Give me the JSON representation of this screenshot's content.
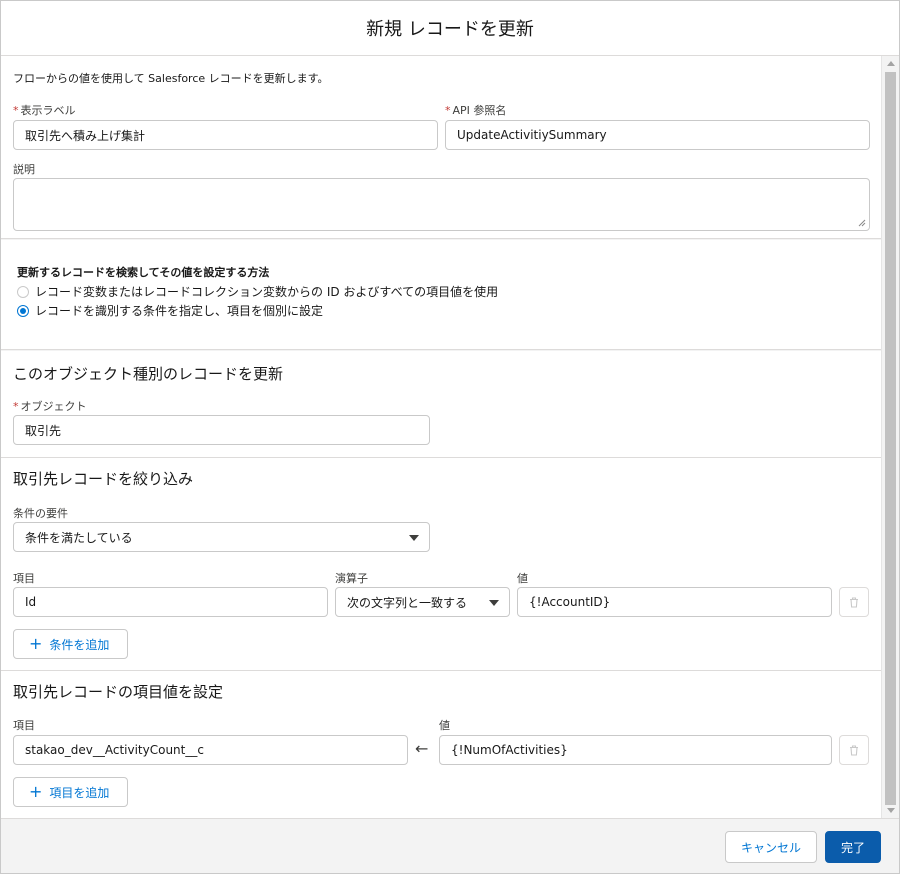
{
  "modal": {
    "title": "新規 レコードを更新",
    "footer": {
      "cancel_label": "キャンセル",
      "done_label": "完了"
    }
  },
  "header_section": {
    "description_text": "フローからの値を使用して Salesforce レコードを更新します。",
    "label_field": {
      "required_mark": "*",
      "label": "表示ラベル",
      "value": "取引先へ積み上げ集計"
    },
    "api_name_field": {
      "required_mark": "*",
      "label": "API 参照名",
      "value": "UpdateActivitiySummary"
    },
    "description_field": {
      "label": "説明",
      "value": ""
    }
  },
  "method_section": {
    "title": "更新するレコードを検索してその値を設定する方法",
    "options": [
      {
        "label": "レコード変数またはレコードコレクション変数からの ID およびすべての項目値を使用",
        "selected": false
      },
      {
        "label": "レコードを識別する条件を指定し、項目を個別に設定",
        "selected": true
      }
    ]
  },
  "object_section": {
    "title": "このオブジェクト種別のレコードを更新",
    "object_field": {
      "required_mark": "*",
      "label": "オブジェクト",
      "value": "取引先"
    }
  },
  "filter_section": {
    "title": "取引先レコードを絞り込み",
    "condition_requirement": {
      "label": "条件の要件",
      "value": "条件を満たしている"
    },
    "columns": {
      "field": "項目",
      "operator": "演算子",
      "value": "値"
    },
    "row": {
      "field": "Id",
      "operator": "次の文字列と一致する",
      "value": "{!AccountID}"
    },
    "add_label": "条件を追加"
  },
  "set_section": {
    "title": "取引先レコードの項目値を設定",
    "columns": {
      "field": "項目",
      "value": "値"
    },
    "row": {
      "field": "stakao_dev__ActivityCount__c",
      "value": "{!NumOfActivities}"
    },
    "add_label": "項目を追加"
  },
  "colors": {
    "brand": "#0b5cab",
    "link": "#0176d3",
    "required": "#c23934",
    "border": "#c9c9c9"
  },
  "icons": {
    "add": "plus-icon",
    "delete": "trash-icon",
    "assign": "arrow-left-icon",
    "dropdown": "caret-down-icon"
  }
}
